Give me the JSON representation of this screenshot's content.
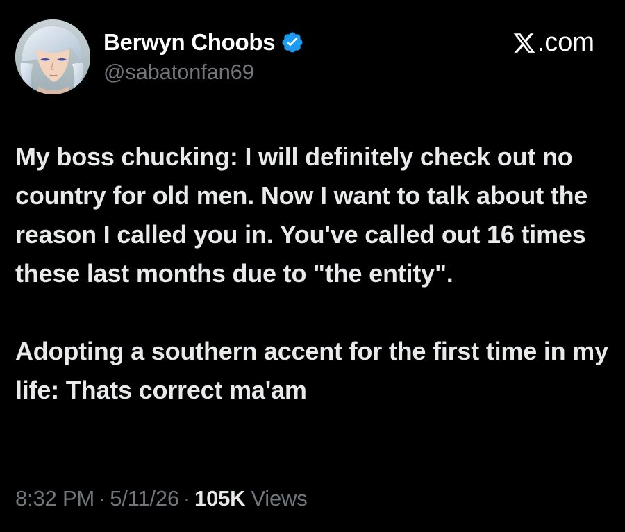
{
  "author": {
    "display_name": "Berwyn Choobs",
    "handle": "@sabatonfan69",
    "verified": true,
    "verified_color": "#1d9bf0",
    "avatar_icon": "anime-character-avatar"
  },
  "watermark": {
    "site_text": ".com",
    "logo_icon": "x-logo-icon"
  },
  "tweet": {
    "paragraphs": [
      "My boss chucking: I will definitely check out no country for old men. Now I want to talk about the reason I called you in. You've called out 16 times these last months due to \"the entity\".",
      "Adopting a southern accent for the first time in my life: Thats correct ma'am"
    ]
  },
  "meta": {
    "time": "8:32 PM",
    "separator": "·",
    "date": "5/11/26",
    "views_count": "105K",
    "views_label": "Views"
  },
  "colors": {
    "background": "#000000",
    "primary_text": "#e7e9ea",
    "secondary_text": "#71767b"
  }
}
